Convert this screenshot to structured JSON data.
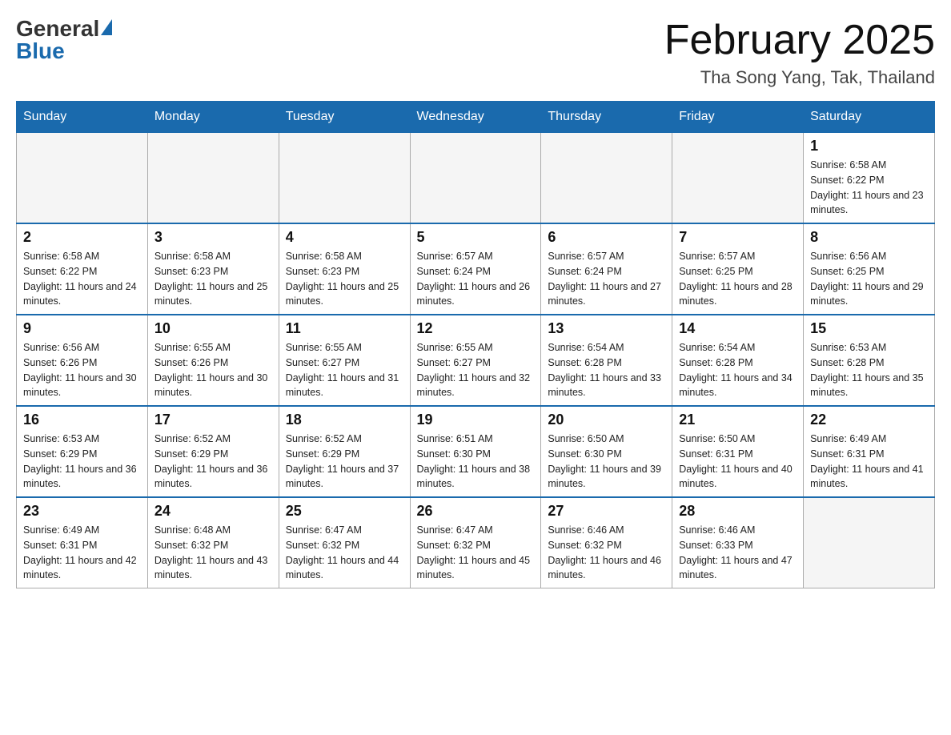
{
  "header": {
    "logo_general": "General",
    "logo_blue": "Blue",
    "month_title": "February 2025",
    "location": "Tha Song Yang, Tak, Thailand"
  },
  "days_of_week": [
    "Sunday",
    "Monday",
    "Tuesday",
    "Wednesday",
    "Thursday",
    "Friday",
    "Saturday"
  ],
  "weeks": [
    {
      "days": [
        {
          "number": "",
          "empty": true
        },
        {
          "number": "",
          "empty": true
        },
        {
          "number": "",
          "empty": true
        },
        {
          "number": "",
          "empty": true
        },
        {
          "number": "",
          "empty": true
        },
        {
          "number": "",
          "empty": true
        },
        {
          "number": "1",
          "sunrise": "6:58 AM",
          "sunset": "6:22 PM",
          "daylight": "11 hours and 23 minutes."
        }
      ]
    },
    {
      "days": [
        {
          "number": "2",
          "sunrise": "6:58 AM",
          "sunset": "6:22 PM",
          "daylight": "11 hours and 24 minutes."
        },
        {
          "number": "3",
          "sunrise": "6:58 AM",
          "sunset": "6:23 PM",
          "daylight": "11 hours and 25 minutes."
        },
        {
          "number": "4",
          "sunrise": "6:58 AM",
          "sunset": "6:23 PM",
          "daylight": "11 hours and 25 minutes."
        },
        {
          "number": "5",
          "sunrise": "6:57 AM",
          "sunset": "6:24 PM",
          "daylight": "11 hours and 26 minutes."
        },
        {
          "number": "6",
          "sunrise": "6:57 AM",
          "sunset": "6:24 PM",
          "daylight": "11 hours and 27 minutes."
        },
        {
          "number": "7",
          "sunrise": "6:57 AM",
          "sunset": "6:25 PM",
          "daylight": "11 hours and 28 minutes."
        },
        {
          "number": "8",
          "sunrise": "6:56 AM",
          "sunset": "6:25 PM",
          "daylight": "11 hours and 29 minutes."
        }
      ]
    },
    {
      "days": [
        {
          "number": "9",
          "sunrise": "6:56 AM",
          "sunset": "6:26 PM",
          "daylight": "11 hours and 30 minutes."
        },
        {
          "number": "10",
          "sunrise": "6:55 AM",
          "sunset": "6:26 PM",
          "daylight": "11 hours and 30 minutes."
        },
        {
          "number": "11",
          "sunrise": "6:55 AM",
          "sunset": "6:27 PM",
          "daylight": "11 hours and 31 minutes."
        },
        {
          "number": "12",
          "sunrise": "6:55 AM",
          "sunset": "6:27 PM",
          "daylight": "11 hours and 32 minutes."
        },
        {
          "number": "13",
          "sunrise": "6:54 AM",
          "sunset": "6:28 PM",
          "daylight": "11 hours and 33 minutes."
        },
        {
          "number": "14",
          "sunrise": "6:54 AM",
          "sunset": "6:28 PM",
          "daylight": "11 hours and 34 minutes."
        },
        {
          "number": "15",
          "sunrise": "6:53 AM",
          "sunset": "6:28 PM",
          "daylight": "11 hours and 35 minutes."
        }
      ]
    },
    {
      "days": [
        {
          "number": "16",
          "sunrise": "6:53 AM",
          "sunset": "6:29 PM",
          "daylight": "11 hours and 36 minutes."
        },
        {
          "number": "17",
          "sunrise": "6:52 AM",
          "sunset": "6:29 PM",
          "daylight": "11 hours and 36 minutes."
        },
        {
          "number": "18",
          "sunrise": "6:52 AM",
          "sunset": "6:29 PM",
          "daylight": "11 hours and 37 minutes."
        },
        {
          "number": "19",
          "sunrise": "6:51 AM",
          "sunset": "6:30 PM",
          "daylight": "11 hours and 38 minutes."
        },
        {
          "number": "20",
          "sunrise": "6:50 AM",
          "sunset": "6:30 PM",
          "daylight": "11 hours and 39 minutes."
        },
        {
          "number": "21",
          "sunrise": "6:50 AM",
          "sunset": "6:31 PM",
          "daylight": "11 hours and 40 minutes."
        },
        {
          "number": "22",
          "sunrise": "6:49 AM",
          "sunset": "6:31 PM",
          "daylight": "11 hours and 41 minutes."
        }
      ]
    },
    {
      "days": [
        {
          "number": "23",
          "sunrise": "6:49 AM",
          "sunset": "6:31 PM",
          "daylight": "11 hours and 42 minutes."
        },
        {
          "number": "24",
          "sunrise": "6:48 AM",
          "sunset": "6:32 PM",
          "daylight": "11 hours and 43 minutes."
        },
        {
          "number": "25",
          "sunrise": "6:47 AM",
          "sunset": "6:32 PM",
          "daylight": "11 hours and 44 minutes."
        },
        {
          "number": "26",
          "sunrise": "6:47 AM",
          "sunset": "6:32 PM",
          "daylight": "11 hours and 45 minutes."
        },
        {
          "number": "27",
          "sunrise": "6:46 AM",
          "sunset": "6:32 PM",
          "daylight": "11 hours and 46 minutes."
        },
        {
          "number": "28",
          "sunrise": "6:46 AM",
          "sunset": "6:33 PM",
          "daylight": "11 hours and 47 minutes."
        },
        {
          "number": "",
          "empty": true
        }
      ]
    }
  ]
}
